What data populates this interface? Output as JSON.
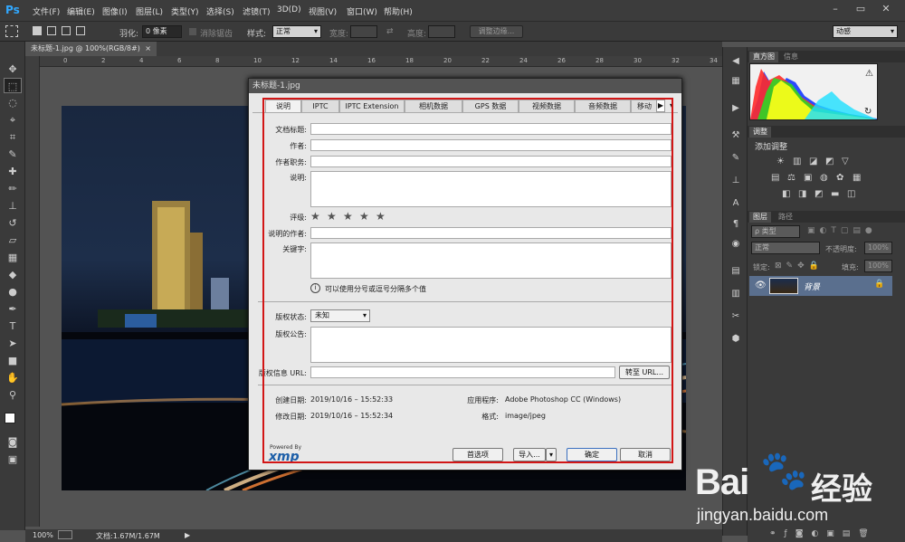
{
  "app": {
    "logo": "Ps"
  },
  "menu": [
    "文件(F)",
    "编辑(E)",
    "图像(I)",
    "图层(L)",
    "类型(Y)",
    "选择(S)",
    "滤镜(T)",
    "3D(D)",
    "视图(V)",
    "窗口(W)",
    "帮助(H)"
  ],
  "window_controls": [
    "–",
    "▭",
    "✕"
  ],
  "options": {
    "feather_label": "羽化:",
    "feather_value": "0 像素",
    "antialias_label": "消除锯齿",
    "style_label": "样式:",
    "style_value": "正常",
    "width_label": "宽度:",
    "height_label": "高度:",
    "refine_label": "调整边缘...",
    "workspace": "动感"
  },
  "document_tab": {
    "title": "未标题-1.jpg @ 100%(RGB/8#)",
    "close": "×"
  },
  "ruler_ticks": [
    "0",
    "2",
    "4",
    "6",
    "8",
    "10",
    "12",
    "14",
    "16",
    "18",
    "20",
    "22",
    "24",
    "26",
    "28",
    "30",
    "32",
    "34"
  ],
  "status": {
    "zoom": "100%",
    "doc": "文档:1.67M/1.67M"
  },
  "panels": {
    "histogram_tabs": [
      "直方图",
      "信息"
    ],
    "adjustments_tab": "调整",
    "adjustments_title": "添加调整",
    "layers_tabs": [
      "图层",
      "路径"
    ],
    "layer_filter": "ρ 类型",
    "blend_mode": "正常",
    "opacity_label": "不透明度:",
    "opacity_value": "100%",
    "lock_label": "锁定:",
    "fill_label": "填充:",
    "fill_value": "100%",
    "layer_name": "背景"
  },
  "dialog": {
    "title": "未标题-1.jpg",
    "tabs": [
      "说明",
      "IPTC",
      "IPTC Extension",
      "相机数据",
      "GPS 数据",
      "视频数据",
      "音频数据",
      "移动"
    ],
    "fields": {
      "doc_title": "文档标题:",
      "author": "作者:",
      "author_title": "作者职务:",
      "description": "说明:",
      "rating": "评级:",
      "desc_writer": "说明的作者:",
      "keywords": "关键字:",
      "keywords_hint": "可以使用分号或逗号分隔多个值",
      "copyright_status": "版权状态:",
      "copyright_status_value": "未知",
      "copyright_notice": "版权公告:",
      "copyright_url": "版权信息 URL:",
      "goto_url": "转至 URL...",
      "created_label": "创建日期:",
      "created_value": "2019/10/16 – 15:52:33",
      "modified_label": "修改日期:",
      "modified_value": "2019/10/16 – 15:52:34",
      "app_label": "应用程序:",
      "app_value": "Adobe Photoshop CC (Windows)",
      "format_label": "格式:",
      "format_value": "image/jpeg"
    },
    "rating_stars": 5,
    "powered_by": "Powered By",
    "xmp": "xmp",
    "buttons": {
      "prefs": "首选项",
      "import": "导入...",
      "ok": "确定",
      "cancel": "取消"
    }
  },
  "watermark": {
    "brand": "Bai",
    "brand_cn": "经验",
    "url": "jingyan.baidu.com"
  }
}
